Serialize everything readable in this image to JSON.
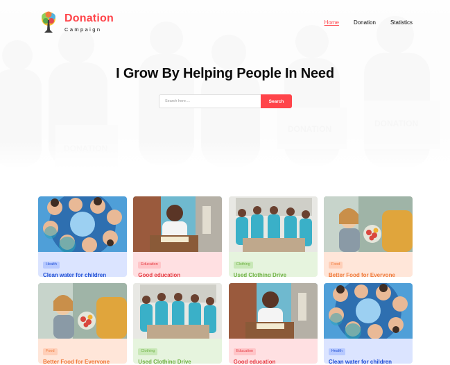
{
  "brand": {
    "name": "Donation",
    "subtitle": "Campaign"
  },
  "nav": {
    "items": [
      {
        "label": "Home",
        "active": true
      },
      {
        "label": "Donation",
        "active": false
      },
      {
        "label": "Statistics",
        "active": false
      }
    ]
  },
  "hero": {
    "title": "I Grow By Helping People In Need",
    "search_placeholder": "Search here....",
    "search_button": "Search"
  },
  "categories": {
    "Health": {
      "card_bg": "#dbe4ff",
      "badge_bg": "#b8caff",
      "text": "#1f4fd6",
      "photo": "health"
    },
    "Education": {
      "card_bg": "#ffe0e2",
      "badge_bg": "#ffc5c8",
      "text": "#e53f46",
      "photo": "education"
    },
    "Clothing": {
      "card_bg": "#e6f4de",
      "badge_bg": "#c9e8b8",
      "text": "#6fb244",
      "photo": "clothing"
    },
    "Food": {
      "card_bg": "#ffe6d9",
      "badge_bg": "#ffcfb8",
      "text": "#ef7a3a",
      "photo": "food"
    }
  },
  "cards": [
    {
      "category": "Health",
      "title": "Clean water for children"
    },
    {
      "category": "Education",
      "title": "Good education"
    },
    {
      "category": "Clothing",
      "title": "Used Clothing Drive"
    },
    {
      "category": "Food",
      "title": "Better Food for Everyone"
    },
    {
      "category": "Food",
      "title": "Better Food for Everyone"
    },
    {
      "category": "Clothing",
      "title": "Used Clothing Drive"
    },
    {
      "category": "Education",
      "title": "Good education"
    },
    {
      "category": "Health",
      "title": "Clean water for children"
    }
  ]
}
